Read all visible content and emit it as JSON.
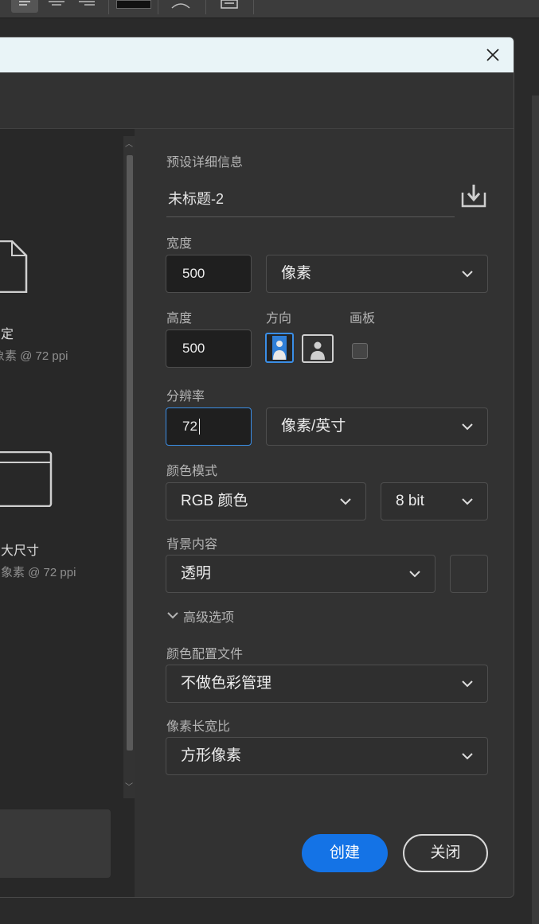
{
  "left_presets": [
    {
      "name": "定",
      "sub": "象素 @ 72 ppi"
    },
    {
      "name": "大尺寸",
      "sub": "象素 @ 72 ppi"
    }
  ],
  "form": {
    "preset_details_label": "预设详细信息",
    "document_name": "未标题-2",
    "width_label": "宽度",
    "width_value": "500",
    "width_unit": "像素",
    "height_label": "高度",
    "height_value": "500",
    "orientation_label": "方向",
    "artboard_label": "画板",
    "resolution_label": "分辨率",
    "resolution_value": "72",
    "resolution_unit": "像素/英寸",
    "color_mode_label": "颜色模式",
    "color_mode": "RGB 颜色",
    "bit_depth": "8 bit",
    "background_label": "背景内容",
    "background": "透明",
    "advanced_label": "高级选项",
    "color_profile_label": "颜色配置文件",
    "color_profile": "不做色彩管理",
    "pixel_aspect_label": "像素长宽比",
    "pixel_aspect": "方形像素"
  },
  "buttons": {
    "create": "创建",
    "close": "关闭"
  },
  "colors": {
    "accent": "#1473e6",
    "focus": "#3a8ee6"
  }
}
